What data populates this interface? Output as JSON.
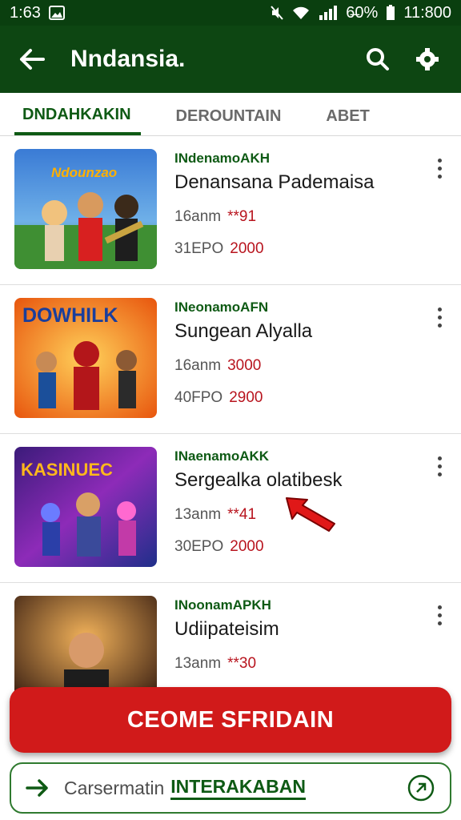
{
  "status": {
    "time": "1:63",
    "battery": "6̶0%",
    "clock": "11:800"
  },
  "appbar": {
    "title": "Nndansia."
  },
  "tabs": [
    {
      "label": "DNDAHKAKIN"
    },
    {
      "label": "DEROUNTAIN"
    },
    {
      "label": "ABET"
    }
  ],
  "items": [
    {
      "thumb_text": "Ndounzao",
      "developer": "INdenamoAKH",
      "name": "Denansana Pademaisa",
      "line1_label": "16anm",
      "line1_value": "**91",
      "line2_label": "31EPO",
      "line2_value": "2000"
    },
    {
      "thumb_text": "DOWHILK",
      "developer": "INeonamoAFN",
      "name": "Sungean Alyalla",
      "line1_label": "16anm",
      "line1_value": "3000",
      "line2_label": "40FPO",
      "line2_value": "2900"
    },
    {
      "thumb_text": "KASINUEC",
      "developer": "INaenamoAKK",
      "name": "Sergealka olatibesk",
      "line1_label": "13anm",
      "line1_value": "**41",
      "line2_label": "30EPO",
      "line2_value": "2000"
    },
    {
      "thumb_text": "",
      "developer": "INoonamAPKH",
      "name": "Udiipateisim",
      "line1_label": "13anm",
      "line1_value": "**30",
      "line2_label": "",
      "line2_value": ""
    }
  ],
  "buttons": {
    "primary": "CEOME SFRIDAIN",
    "secondary_label": "Carsermatin",
    "secondary_strong": "INTERAKABAN"
  },
  "colors": {
    "brand": "#0d4612",
    "accent": "#d11a1a"
  }
}
